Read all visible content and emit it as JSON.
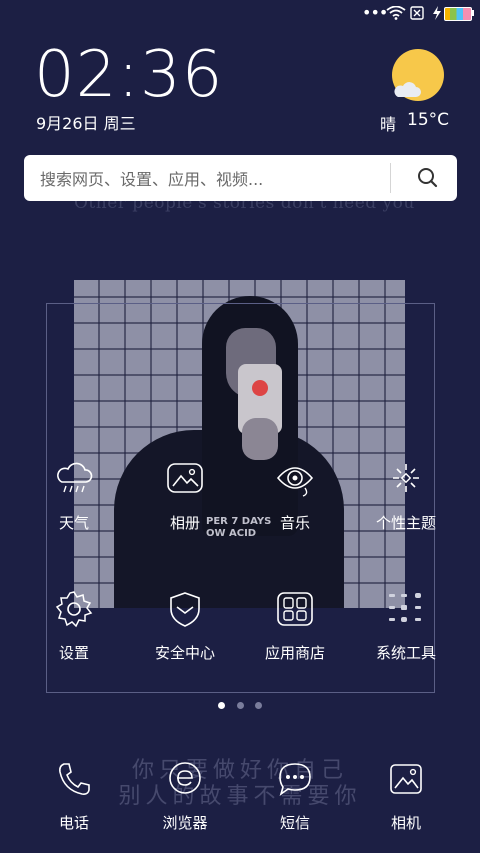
{
  "status_bar": {
    "dots": "•••"
  },
  "clock": {
    "time": "02:36",
    "date": "9月26日 周三"
  },
  "weather": {
    "condition": "晴",
    "temperature": "15°C"
  },
  "search": {
    "placeholder": "搜索网页、设置、应用、视频..."
  },
  "wallpaper": {
    "quote_en": "Other people's stories don't need you",
    "quote_cn_line1": "你只要做好你自己",
    "quote_cn_line2": "别人的故事不需要你",
    "shirt_text": "PER 7 DAYS\nOW ACID"
  },
  "apps": [
    {
      "label": "天气",
      "icon": "weather-icon"
    },
    {
      "label": "相册",
      "icon": "gallery-icon"
    },
    {
      "label": "音乐",
      "icon": "music-icon"
    },
    {
      "label": "个性主题",
      "icon": "themes-icon"
    },
    {
      "label": "设置",
      "icon": "settings-icon"
    },
    {
      "label": "安全中心",
      "icon": "security-icon"
    },
    {
      "label": "应用商店",
      "icon": "app-store-icon"
    },
    {
      "label": "系统工具",
      "icon": "system-tools-icon"
    }
  ],
  "pager": {
    "pages": 3,
    "current": 1
  },
  "dock": [
    {
      "label": "电话",
      "icon": "phone-icon"
    },
    {
      "label": "浏览器",
      "icon": "browser-icon"
    },
    {
      "label": "短信",
      "icon": "messages-icon"
    },
    {
      "label": "相机",
      "icon": "camera-icon"
    }
  ],
  "colors": {
    "background": "#1c1f44",
    "sun": "#f7c84a",
    "accent_icon": "#ffffff"
  }
}
